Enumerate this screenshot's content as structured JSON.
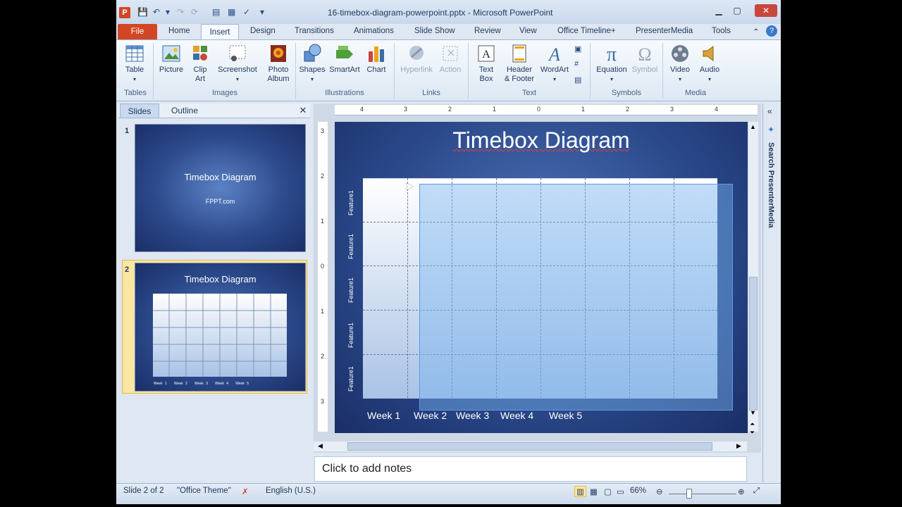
{
  "window": {
    "title": "16-timebox-diagram-powerpoint.pptx - Microsoft PowerPoint",
    "app_icon": "P"
  },
  "tabs": [
    "File",
    "Home",
    "Insert",
    "Design",
    "Transitions",
    "Animations",
    "Slide Show",
    "Review",
    "View",
    "Office Timeline+",
    "PresenterMedia",
    "Tools"
  ],
  "active_tab": "Insert",
  "ribbon": {
    "table": "Table",
    "picture": "Picture",
    "clip_art": "Clip Art",
    "screenshot": "Screenshot",
    "photo_album": "Photo Album",
    "shapes": "Shapes",
    "smartart": "SmartArt",
    "chart": "Chart",
    "hyperlink": "Hyperlink",
    "action": "Action",
    "text_box": "Text Box",
    "header_footer": "Header & Footer",
    "wordart": "WordArt",
    "equation": "Equation",
    "symbol": "Symbol",
    "video": "Video",
    "audio": "Audio",
    "groups": {
      "tables": "Tables",
      "images": "Images",
      "illustrations": "Illustrations",
      "links": "Links",
      "text": "Text",
      "symbols": "Symbols",
      "media": "Media"
    }
  },
  "panel": {
    "tab_slides": "Slides",
    "tab_outline": "Outline",
    "close": "✕",
    "slides": [
      {
        "number": "1",
        "title": "Timebox Diagram",
        "subtitle": "FPPT.com"
      },
      {
        "number": "2",
        "title": "Timebox Diagram",
        "weeks": [
          "Week 1",
          "Week 2",
          "Week 3",
          "Week 4",
          "Week 5"
        ]
      }
    ]
  },
  "ruler": {
    "h_ticks": [
      "4",
      "3",
      "2",
      "1",
      "0",
      "1",
      "2",
      "3",
      "4"
    ],
    "v_ticks": [
      "3",
      "2",
      "1",
      "0",
      "1",
      "2",
      "3"
    ]
  },
  "slide": {
    "title": "Timebox Diagram",
    "features": [
      "Feature1",
      "Feature1",
      "Feature1",
      "Feature1",
      "Feature1"
    ],
    "weeks": [
      "Week 1",
      "Week 2",
      "Week 3",
      "Week 4",
      "Week 5"
    ]
  },
  "side_pane": {
    "label": "Search PresenterMedia"
  },
  "notes": {
    "placeholder": "Click to add notes"
  },
  "status": {
    "slide": "Slide 2 of 2",
    "theme": "\"Office Theme\"",
    "language": "English (U.S.)",
    "zoom": "66%"
  }
}
